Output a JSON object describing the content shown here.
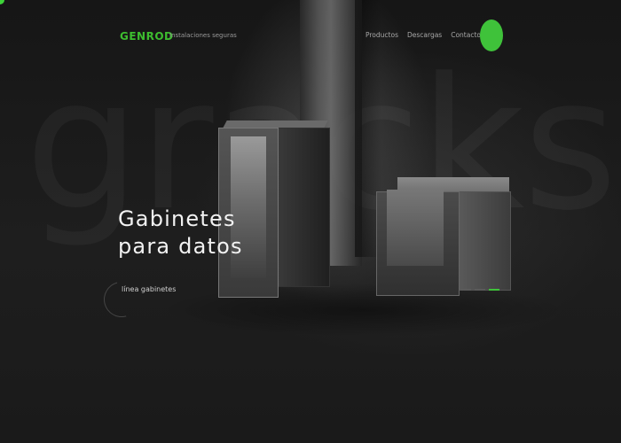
{
  "brand": {
    "logo": "GENROD",
    "tagline": "Instalaciones seguras",
    "accent_color": "#3fc23a"
  },
  "nav": {
    "items": [
      {
        "label": "Productos"
      },
      {
        "label": "Descargas"
      },
      {
        "label": "Contacto"
      }
    ],
    "cta_icon": "green-circle-button"
  },
  "hero": {
    "background_word": "gracks",
    "title_line1": "Gabinetes",
    "title_line2": "para datos",
    "link_label": "línea gabinetes",
    "slides": [
      {
        "active": false
      },
      {
        "active": false
      },
      {
        "active": true
      }
    ]
  }
}
